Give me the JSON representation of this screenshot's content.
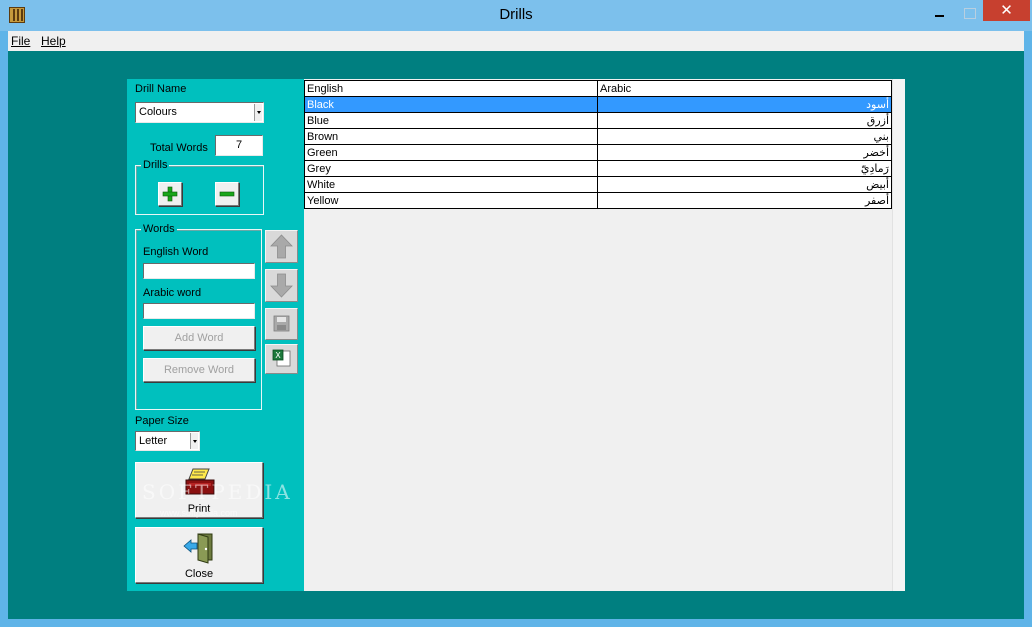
{
  "window": {
    "title": "Drills",
    "close_glyph": "✕"
  },
  "menu": {
    "items": [
      {
        "label": "File"
      },
      {
        "label": "Help"
      }
    ]
  },
  "left": {
    "drill_name_label": "Drill Name",
    "drill_name_value": "Colours",
    "total_words_label": "Total Words",
    "total_words_value": "7",
    "drills_group_label": "Drills",
    "words_group_label": "Words",
    "english_word_label": "English Word",
    "english_word_value": "",
    "arabic_word_label": "Arabic word",
    "arabic_word_value": "",
    "add_word_label": "Add Word",
    "remove_word_label": "Remove Word",
    "paper_size_label": "Paper Size",
    "paper_size_value": "Letter",
    "print_label": "Print",
    "close_label": "Close"
  },
  "grid": {
    "columns": [
      "English",
      "Arabic"
    ],
    "rows": [
      {
        "english": "Black",
        "arabic": "أسود",
        "selected": true
      },
      {
        "english": "Blue",
        "arabic": "أزرق"
      },
      {
        "english": "Brown",
        "arabic": "بني"
      },
      {
        "english": "Green",
        "arabic": "أخضر"
      },
      {
        "english": "Grey",
        "arabic": "رَمادِيّ"
      },
      {
        "english": "White",
        "arabic": "أبيض"
      },
      {
        "english": "Yellow",
        "arabic": "أصفر"
      }
    ]
  },
  "watermark": {
    "text": "SOFTPEDIA",
    "sub": "www.softpedia.com"
  },
  "icons": {
    "app": "app-icon",
    "add_drill": "plus-icon",
    "remove_drill": "minus-icon",
    "move_up": "arrow-up-icon",
    "move_down": "arrow-down-icon",
    "save": "save-icon",
    "excel": "excel-icon",
    "print": "printer-icon",
    "close": "exit-door-icon"
  },
  "colors": {
    "client_background": "#007f80",
    "panel_background": "#00c0be",
    "selection": "#3399ff"
  }
}
